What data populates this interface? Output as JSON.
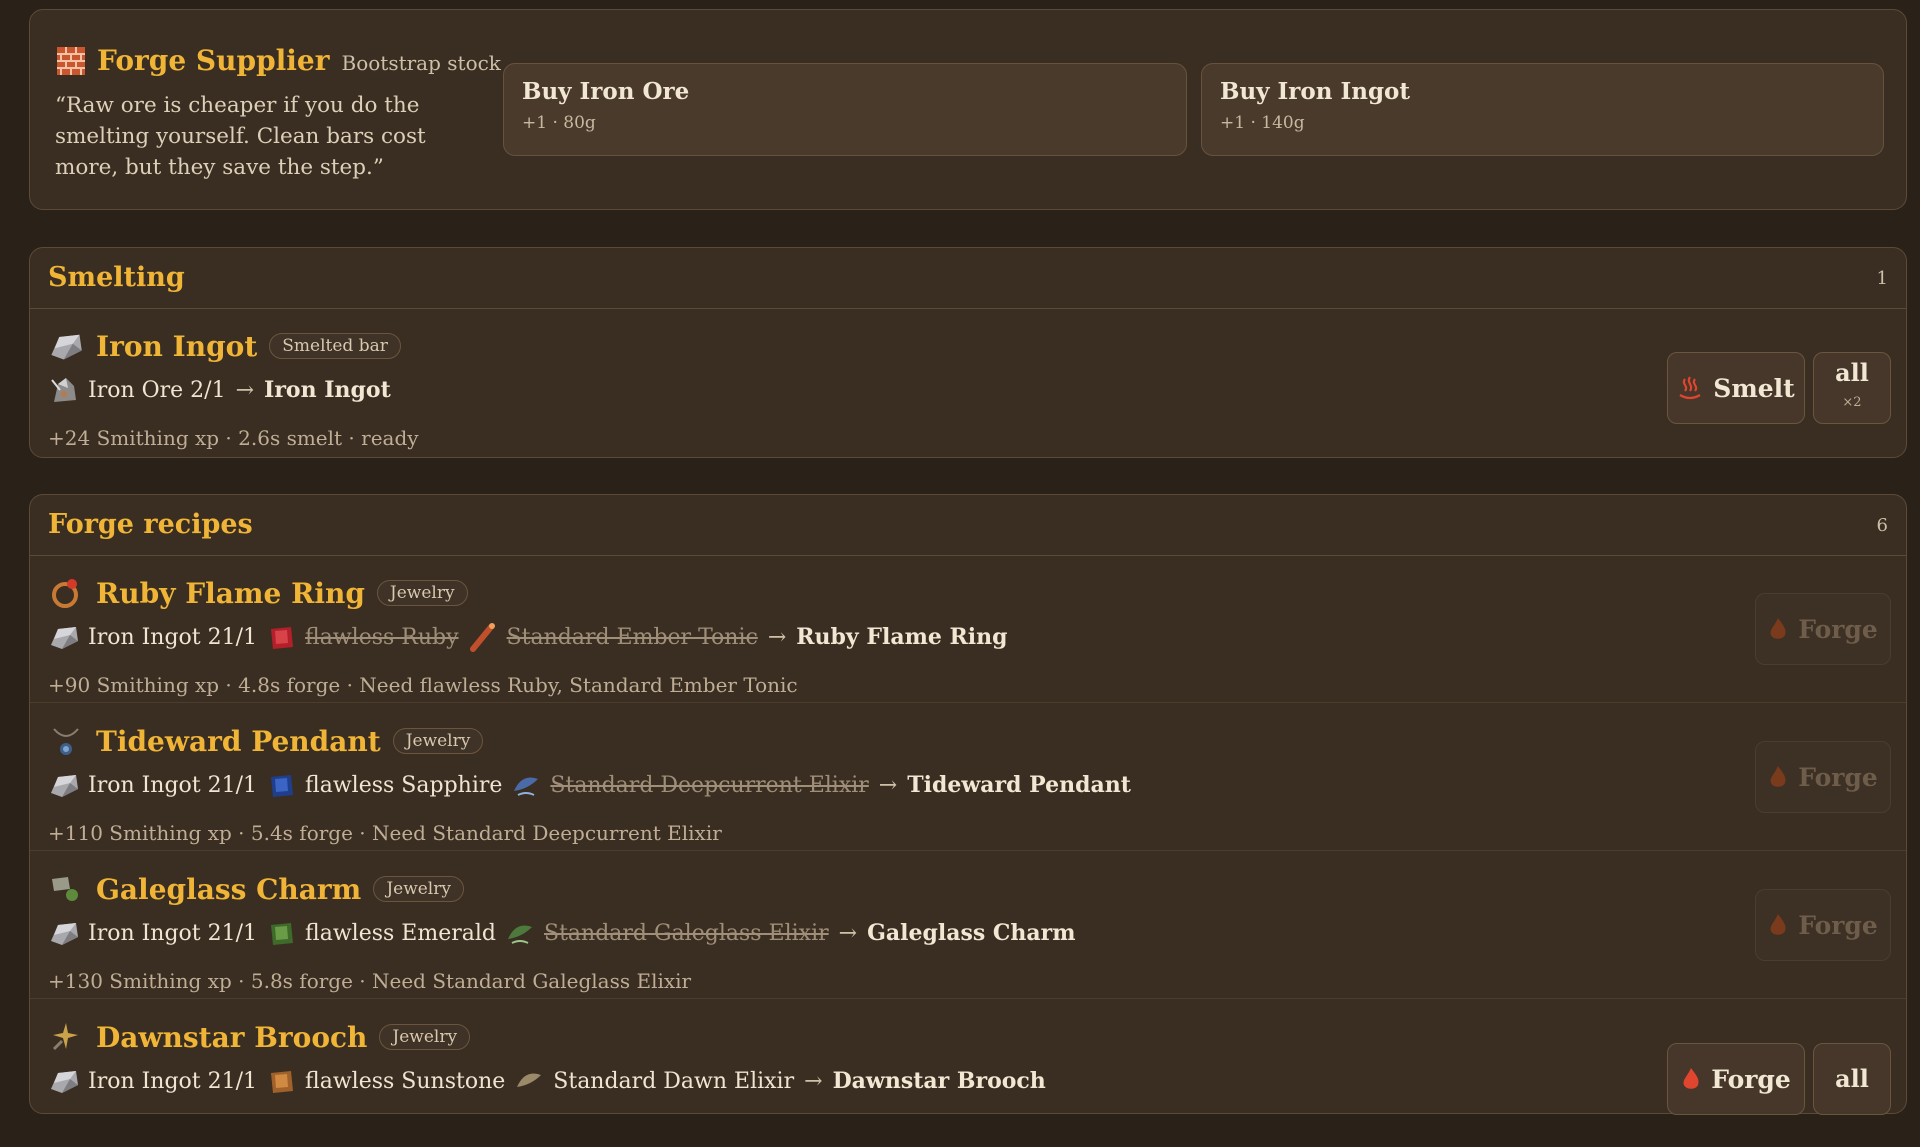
{
  "supplier": {
    "name": "Forge Supplier",
    "subtitle": "Bootstrap stock",
    "quote": "“Raw ore is cheaper if you do the smelting yourself. Clean bars cost more, but they save the step.”",
    "buttons": [
      {
        "label": "Buy Iron Ore",
        "meta": "+1 · 80g"
      },
      {
        "label": "Buy Iron Ingot",
        "meta": "+1 · 140g"
      }
    ]
  },
  "smelting": {
    "title": "Smelting",
    "count": "1",
    "item": {
      "name": "Iron Ingot",
      "tag": "Smelted bar",
      "input": "Iron Ore 2/1",
      "arrow": "→",
      "output": "Iron Ingot",
      "meta": "+24 Smithing xp · 2.6s smelt · ready",
      "action": "Smelt",
      "all_label": "all",
      "all_count": "×2"
    }
  },
  "forge": {
    "title": "Forge recipes",
    "count": "6",
    "recipes": [
      {
        "name": "Ruby Flame Ring",
        "tag": "Jewelry",
        "ingot": "Iron Ingot 21/1",
        "gem": "flawless Ruby",
        "gem_missing": true,
        "elixir": "Standard Ember Tonic",
        "elixir_missing": true,
        "output": "Ruby Flame Ring",
        "meta": "+90 Smithing xp · 4.8s forge · Need flawless Ruby, Standard Ember Tonic",
        "action": "Forge",
        "enabled": false
      },
      {
        "name": "Tideward Pendant",
        "tag": "Jewelry",
        "ingot": "Iron Ingot 21/1",
        "gem": "flawless Sapphire",
        "gem_missing": false,
        "elixir": "Standard Deepcurrent Elixir",
        "elixir_missing": true,
        "output": "Tideward Pendant",
        "meta": "+110 Smithing xp · 5.4s forge · Need Standard Deepcurrent Elixir",
        "action": "Forge",
        "enabled": false
      },
      {
        "name": "Galeglass Charm",
        "tag": "Jewelry",
        "ingot": "Iron Ingot 21/1",
        "gem": "flawless Emerald",
        "gem_missing": false,
        "elixir": "Standard Galeglass Elixir",
        "elixir_missing": true,
        "output": "Galeglass Charm",
        "meta": "+130 Smithing xp · 5.8s forge · Need Standard Galeglass Elixir",
        "action": "Forge",
        "enabled": false
      },
      {
        "name": "Dawnstar Brooch",
        "tag": "Jewelry",
        "ingot": "Iron Ingot 21/1",
        "gem": "flawless Sunstone",
        "gem_missing": false,
        "elixir": "Standard Dawn Elixir",
        "elixir_missing": false,
        "output": "Dawnstar Brooch",
        "action": "Forge",
        "enabled": true,
        "all_label": "all"
      }
    ]
  },
  "colors": {
    "accent": "#f0b536",
    "panel": "#3a2e22",
    "background": "#2a2119"
  }
}
